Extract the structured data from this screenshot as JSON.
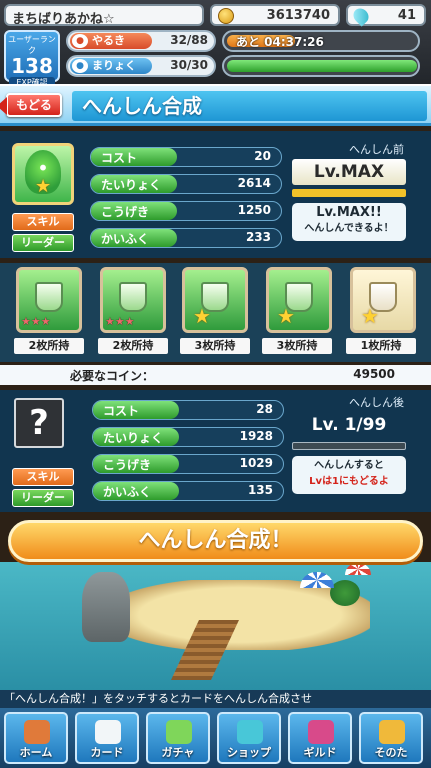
{
  "topbar": {
    "player_name": "まちばりあかね☆",
    "coins": "3613740",
    "gems": "41",
    "rank_label": "ユーザーランク",
    "rank": "138",
    "exp_label": "EXP確認",
    "yaruki_label": "やるき",
    "yaruki_value": "32/88",
    "timer_text": "あと 04:37:26",
    "timer_progress": 0.36,
    "maryoku_label": "まりょく",
    "maryoku_value": "30/30",
    "maryoku_progress": 1.0
  },
  "header": {
    "back_label": "もどる",
    "title": "へんしん合成"
  },
  "before": {
    "skill_label": "スキル",
    "leader_label": "リーダー",
    "stats": [
      {
        "label": "コスト",
        "value": "20"
      },
      {
        "label": "たいりょく",
        "value": "2614"
      },
      {
        "label": "こうげき",
        "value": "1250"
      },
      {
        "label": "かいふく",
        "value": "233"
      }
    ],
    "level_heading": "へんしん前",
    "level": "Lv.MAX",
    "message_title": "Lv.MAX!!",
    "message_sub": "へんしんできるよ！"
  },
  "materials": [
    {
      "owned": "2枚所持",
      "stars": "★★★"
    },
    {
      "owned": "2枚所持",
      "stars": "★★★"
    },
    {
      "owned": "3枚所持",
      "stars": ""
    },
    {
      "owned": "3枚所持",
      "stars": ""
    },
    {
      "owned": "1枚所持",
      "stars": ""
    }
  ],
  "cost": {
    "label": "必要なコイン：",
    "value": "49500"
  },
  "after": {
    "card_placeholder": "?",
    "skill_label": "スキル",
    "leader_label": "リーダー",
    "stats": [
      {
        "label": "コスト",
        "value": "28"
      },
      {
        "label": "たいりょく",
        "value": "1928"
      },
      {
        "label": "こうげき",
        "value": "1029"
      },
      {
        "label": "かいふく",
        "value": "135"
      }
    ],
    "level_heading": "へんしん後",
    "level": "Lv. 1/99",
    "message_line1": "へんしんすると",
    "message_line2": "Lvは1にもどるよ"
  },
  "action": {
    "button_label": "へんしん合成！"
  },
  "ticker": {
    "text": "「へんしん合成！」をタッチするとカードをへんしん合成させ"
  },
  "nav": [
    {
      "label": "ホーム",
      "icon": "home-icon",
      "color": "#e07a3a"
    },
    {
      "label": "カード",
      "icon": "card-icon",
      "color": "#f2f6f8"
    },
    {
      "label": "ガチャ",
      "icon": "gacha-icon",
      "color": "#7fd65a"
    },
    {
      "label": "ショップ",
      "icon": "shop-icon",
      "color": "#48c7d8"
    },
    {
      "label": "ギルド",
      "icon": "guild-icon",
      "color": "#d84a8a"
    },
    {
      "label": "そのた",
      "icon": "other-icon",
      "color": "#f0b93a"
    }
  ],
  "colors": {
    "accent": "#1e96d4",
    "panel": "#0f3755",
    "stat_fill": "#2e9b2c"
  }
}
